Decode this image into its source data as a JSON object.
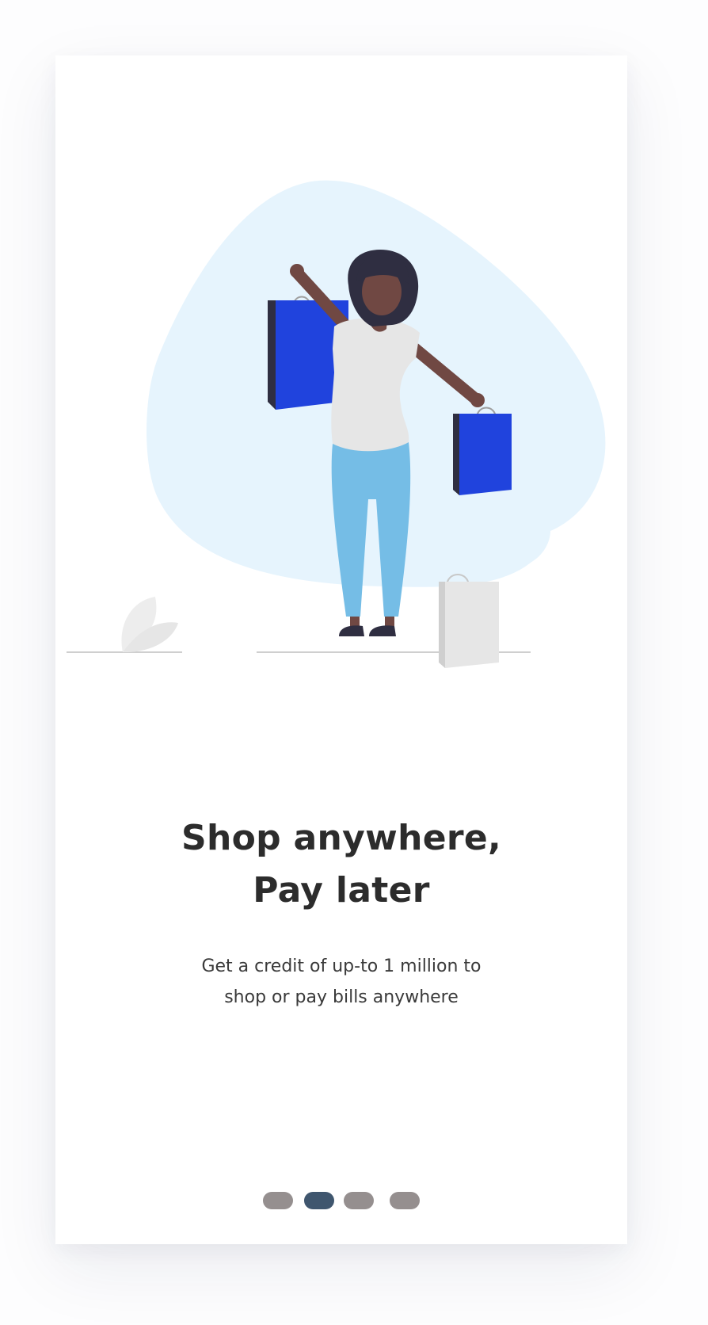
{
  "onboarding": {
    "title_line1": "Shop anywhere,",
    "title_line2": "Pay later",
    "subtitle_line1": "Get a credit of up-to 1 million to",
    "subtitle_line2": "shop or pay bills anywhere"
  },
  "pager": {
    "count": 4,
    "active_index": 1
  },
  "illustration": {
    "subject": "woman holding shopping bags",
    "colors": {
      "blob": "#e6f4fd",
      "bag": "#2043dd",
      "pants": "#75bde6",
      "skin": "#704843",
      "hair": "#2f2e41",
      "shirt": "#e6e6e6"
    }
  },
  "colors": {
    "title": "#2c2c2c",
    "dot_inactive": "#958f8f",
    "dot_active": "#3f566e"
  }
}
